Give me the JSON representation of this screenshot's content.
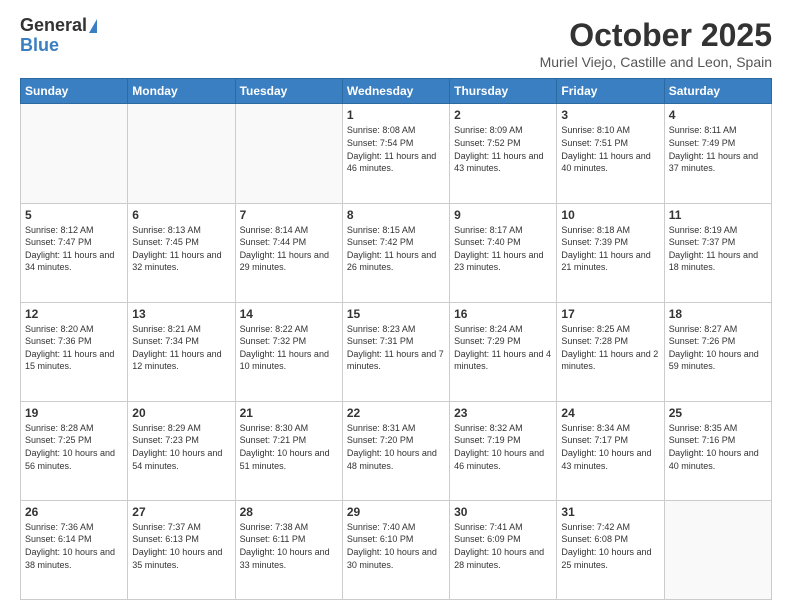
{
  "header": {
    "logo_general": "General",
    "logo_blue": "Blue",
    "month_title": "October 2025",
    "location": "Muriel Viejo, Castille and Leon, Spain"
  },
  "weekdays": [
    "Sunday",
    "Monday",
    "Tuesday",
    "Wednesday",
    "Thursday",
    "Friday",
    "Saturday"
  ],
  "weeks": [
    [
      {
        "day": "",
        "info": ""
      },
      {
        "day": "",
        "info": ""
      },
      {
        "day": "",
        "info": ""
      },
      {
        "day": "1",
        "info": "Sunrise: 8:08 AM\nSunset: 7:54 PM\nDaylight: 11 hours\nand 46 minutes."
      },
      {
        "day": "2",
        "info": "Sunrise: 8:09 AM\nSunset: 7:52 PM\nDaylight: 11 hours\nand 43 minutes."
      },
      {
        "day": "3",
        "info": "Sunrise: 8:10 AM\nSunset: 7:51 PM\nDaylight: 11 hours\nand 40 minutes."
      },
      {
        "day": "4",
        "info": "Sunrise: 8:11 AM\nSunset: 7:49 PM\nDaylight: 11 hours\nand 37 minutes."
      }
    ],
    [
      {
        "day": "5",
        "info": "Sunrise: 8:12 AM\nSunset: 7:47 PM\nDaylight: 11 hours\nand 34 minutes."
      },
      {
        "day": "6",
        "info": "Sunrise: 8:13 AM\nSunset: 7:45 PM\nDaylight: 11 hours\nand 32 minutes."
      },
      {
        "day": "7",
        "info": "Sunrise: 8:14 AM\nSunset: 7:44 PM\nDaylight: 11 hours\nand 29 minutes."
      },
      {
        "day": "8",
        "info": "Sunrise: 8:15 AM\nSunset: 7:42 PM\nDaylight: 11 hours\nand 26 minutes."
      },
      {
        "day": "9",
        "info": "Sunrise: 8:17 AM\nSunset: 7:40 PM\nDaylight: 11 hours\nand 23 minutes."
      },
      {
        "day": "10",
        "info": "Sunrise: 8:18 AM\nSunset: 7:39 PM\nDaylight: 11 hours\nand 21 minutes."
      },
      {
        "day": "11",
        "info": "Sunrise: 8:19 AM\nSunset: 7:37 PM\nDaylight: 11 hours\nand 18 minutes."
      }
    ],
    [
      {
        "day": "12",
        "info": "Sunrise: 8:20 AM\nSunset: 7:36 PM\nDaylight: 11 hours\nand 15 minutes."
      },
      {
        "day": "13",
        "info": "Sunrise: 8:21 AM\nSunset: 7:34 PM\nDaylight: 11 hours\nand 12 minutes."
      },
      {
        "day": "14",
        "info": "Sunrise: 8:22 AM\nSunset: 7:32 PM\nDaylight: 11 hours\nand 10 minutes."
      },
      {
        "day": "15",
        "info": "Sunrise: 8:23 AM\nSunset: 7:31 PM\nDaylight: 11 hours\nand 7 minutes."
      },
      {
        "day": "16",
        "info": "Sunrise: 8:24 AM\nSunset: 7:29 PM\nDaylight: 11 hours\nand 4 minutes."
      },
      {
        "day": "17",
        "info": "Sunrise: 8:25 AM\nSunset: 7:28 PM\nDaylight: 11 hours\nand 2 minutes."
      },
      {
        "day": "18",
        "info": "Sunrise: 8:27 AM\nSunset: 7:26 PM\nDaylight: 10 hours\nand 59 minutes."
      }
    ],
    [
      {
        "day": "19",
        "info": "Sunrise: 8:28 AM\nSunset: 7:25 PM\nDaylight: 10 hours\nand 56 minutes."
      },
      {
        "day": "20",
        "info": "Sunrise: 8:29 AM\nSunset: 7:23 PM\nDaylight: 10 hours\nand 54 minutes."
      },
      {
        "day": "21",
        "info": "Sunrise: 8:30 AM\nSunset: 7:21 PM\nDaylight: 10 hours\nand 51 minutes."
      },
      {
        "day": "22",
        "info": "Sunrise: 8:31 AM\nSunset: 7:20 PM\nDaylight: 10 hours\nand 48 minutes."
      },
      {
        "day": "23",
        "info": "Sunrise: 8:32 AM\nSunset: 7:19 PM\nDaylight: 10 hours\nand 46 minutes."
      },
      {
        "day": "24",
        "info": "Sunrise: 8:34 AM\nSunset: 7:17 PM\nDaylight: 10 hours\nand 43 minutes."
      },
      {
        "day": "25",
        "info": "Sunrise: 8:35 AM\nSunset: 7:16 PM\nDaylight: 10 hours\nand 40 minutes."
      }
    ],
    [
      {
        "day": "26",
        "info": "Sunrise: 7:36 AM\nSunset: 6:14 PM\nDaylight: 10 hours\nand 38 minutes."
      },
      {
        "day": "27",
        "info": "Sunrise: 7:37 AM\nSunset: 6:13 PM\nDaylight: 10 hours\nand 35 minutes."
      },
      {
        "day": "28",
        "info": "Sunrise: 7:38 AM\nSunset: 6:11 PM\nDaylight: 10 hours\nand 33 minutes."
      },
      {
        "day": "29",
        "info": "Sunrise: 7:40 AM\nSunset: 6:10 PM\nDaylight: 10 hours\nand 30 minutes."
      },
      {
        "day": "30",
        "info": "Sunrise: 7:41 AM\nSunset: 6:09 PM\nDaylight: 10 hours\nand 28 minutes."
      },
      {
        "day": "31",
        "info": "Sunrise: 7:42 AM\nSunset: 6:08 PM\nDaylight: 10 hours\nand 25 minutes."
      },
      {
        "day": "",
        "info": ""
      }
    ]
  ]
}
